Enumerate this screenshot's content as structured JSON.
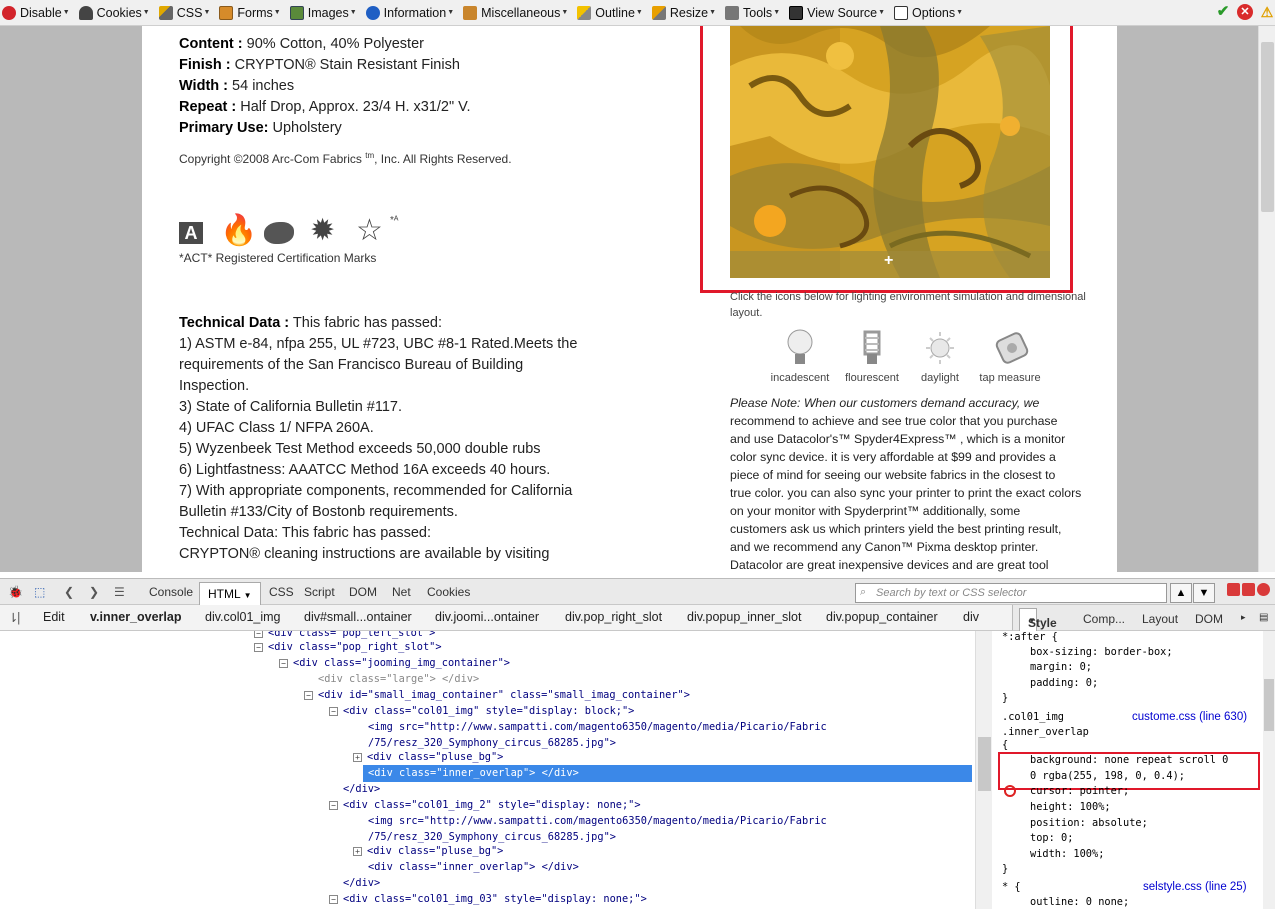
{
  "toolbar": {
    "items": [
      "Disable",
      "Cookies",
      "CSS",
      "Forms",
      "Images",
      "Information",
      "Miscellaneous",
      "Outline",
      "Resize",
      "Tools",
      "View Source",
      "Options"
    ]
  },
  "product": {
    "specs": [
      {
        "label": "Content :",
        "value": "90% Cotton, 40% Polyester"
      },
      {
        "label": "Finish :",
        "value": "CRYPTON® Stain Resistant Finish"
      },
      {
        "label": "Width :",
        "value": "54 inches"
      },
      {
        "label": "Repeat :",
        "value": "Half Drop, Approx. 23/4 H. x31/2\" V."
      },
      {
        "label": "Primary Use:",
        "value": "Upholstery"
      }
    ],
    "copyright_pre": "Copyright ©2008 Arc-Com Fabrics ",
    "copyright_tm": "tm",
    "copyright_post": ", Inc. All Rights Reserved.",
    "cert_caption": "*ACT* Registered Certification Marks",
    "tech_label": "Technical Data :",
    "tech_intro": "This fabric has passed:",
    "tech_lines": [
      "1) ASTM e-84, nfpa 255, UL #723, UBC #8-1 Rated.Meets the",
      "requirements of the San Francisco Bureau of Building",
      "Inspection.",
      "3) State of California Bulletin #117.",
      "4) UFAC Class 1/ NFPA 260A.",
      "5) Wyzenbeek Test Method exceeds 50,000 double rubs",
      "6) Lightfastness: AAATCC Method 16A exceeds 40 hours.",
      "7) With appropriate components, recommended for California",
      "Bulletin #133/City of Bostonb requirements.",
      "Technical Data: This fabric has passed:",
      "CRYPTON® cleaning instructions are available by visiting"
    ],
    "plus": "+",
    "lighting_caption": [
      "Click the icons below for lighting environment simulation and dimensional",
      "layout."
    ],
    "lighting": [
      "incadescent",
      "flourescent",
      "daylight",
      "tap measure"
    ],
    "note_lines": [
      "Please Note: When our customers demand accuracy, we",
      "recommend to achieve and see true color that you purchase",
      "and use Datacolor's™ Spyder4Express™ , which is a monitor",
      "color sync device. it is very affordable at $99 and provides a",
      "piece of mind for seeing our website fabrics in the closest to",
      "true color. you can also sync your printer to print the exact colors",
      "on your monitor with Spyderprint™ additionally, some",
      "customers ask us which printers yield the best printing result,",
      "and we recommend any Canon™ Pixma desktop printer.",
      "Datacolor are great inexpensive devices and are great tool"
    ]
  },
  "devtools": {
    "tabs": [
      "Console",
      "HTML",
      "CSS",
      "Script",
      "DOM",
      "Net",
      "Cookies"
    ],
    "search_placeholder": "Search by text or CSS selector",
    "edit": "Edit",
    "crumbs": [
      "v.inner_overlap",
      "div.col01_img",
      "div#small...ontainer",
      "div.joomi...ontainer",
      "div.pop_right_slot",
      "div.popup_inner_slot",
      "div.popup_container",
      "div"
    ],
    "side_tabs": [
      "Style",
      "Comp...",
      "Layout",
      "DOM"
    ],
    "tree": [
      "<div class=\"pop_left_slot\">",
      "<div class=\"pop_right_slot\">",
      "<div class=\"jooming_img_container\">",
      "<div class=\"large\"> </div>",
      "<div id=\"small_imag_container\" class=\"small_imag_container\">",
      "<div class=\"col01_img\" style=\"display: block;\">",
      "<img src=\"http://www.sampatti.com/magento6350/magento/media/Picario/Fabric",
      "/75/resz_320_Symphony_circus_68285.jpg\">",
      "<div class=\"pluse_bg\">",
      "<div class=\"inner_overlap\"> </div>",
      "</div>",
      "<div class=\"col01_img_2\" style=\"display: none;\">",
      "<img src=\"http://www.sampatti.com/magento6350/magento/media/Picario/Fabric",
      "/75/resz_320_Symphony_circus_68285.jpg\">",
      "<div class=\"pluse_bg\">",
      "<div class=\"inner_overlap\"> </div>",
      "</div>",
      "<div class=\"col01_img_03\" style=\"display: none;\">"
    ],
    "styles": [
      "*:after {",
      "box-sizing: border-box;",
      "margin: 0;",
      "padding: 0;",
      "}",
      ".col01_img",
      ".inner_overlap",
      "{",
      "background: none repeat scroll 0",
      "0 rgba(255, 198, 0, 0.4);",
      "cursor: pointer;",
      "height: 100%;",
      "position: absolute;",
      "top: 0;",
      "width: 100%;",
      "}",
      "* {",
      "outline: 0 none;"
    ],
    "style_links": [
      "custome.css (line 630)",
      "selstyle.css (line 25)"
    ]
  }
}
